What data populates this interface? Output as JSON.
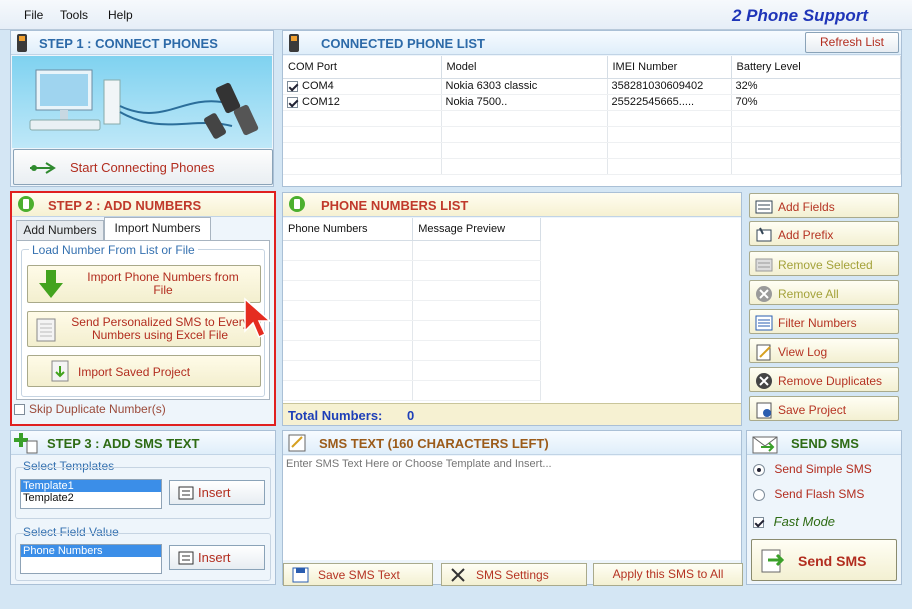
{
  "menu": {
    "file": "File",
    "tools": "Tools",
    "help": "Help"
  },
  "app_title": "2 Phone Support",
  "step1": {
    "title": "STEP 1 : CONNECT PHONES",
    "connect_button": "Start Connecting Phones"
  },
  "connected": {
    "title": "CONNECTED PHONE LIST",
    "refresh": "Refresh List",
    "columns": [
      "COM  Port",
      "Model",
      "IMEI Number",
      "Battery Level"
    ],
    "rows": [
      {
        "port": "COM4",
        "model": "Nokia 6303 classic",
        "imei": "358281030609402",
        "battery": "32%"
      },
      {
        "port": "COM12",
        "model": "Nokia 7500..",
        "imei": "25522545665.....",
        "battery": "70%"
      }
    ]
  },
  "step2": {
    "title": "STEP 2 : ADD NUMBERS",
    "tab_add": "Add Numbers",
    "tab_import": "Import Numbers",
    "group": "Load Number From List or File",
    "import_line1": "Import Phone Numbers from",
    "import_line2": "File",
    "excel_line1": "Send Personalized SMS to Every",
    "excel_line2": "Numbers using Excel File",
    "project": "Import Saved Project",
    "skip": "Skip Duplicate Number(s)"
  },
  "numbers": {
    "title": "PHONE NUMBERS LIST",
    "columns": [
      "Phone Numbers",
      "Message Preview"
    ],
    "total_label": "Total Numbers:",
    "total_value": "0"
  },
  "side_buttons": [
    {
      "label": "Add Fields",
      "name": "add-fields-button",
      "icon": "fields-icon"
    },
    {
      "label": "Add Prefix",
      "name": "add-prefix-button",
      "icon": "prefix-icon"
    },
    {
      "label": "Remove Selected",
      "name": "remove-selected-button",
      "icon": "remove-selected-icon"
    },
    {
      "label": "Remove All",
      "name": "remove-all-button",
      "icon": "remove-all-icon"
    },
    {
      "label": "Filter Numbers",
      "name": "filter-numbers-button",
      "icon": "filter-icon"
    },
    {
      "label": "View Log",
      "name": "view-log-button",
      "icon": "log-icon"
    },
    {
      "label": "Remove Duplicates",
      "name": "remove-duplicates-button",
      "icon": "duplicates-icon"
    },
    {
      "label": "Save Project",
      "name": "save-project-button",
      "icon": "save-icon"
    }
  ],
  "step3": {
    "title": "STEP 3 : ADD SMS TEXT",
    "templates_label": "Select Templates",
    "templates": [
      "Template1",
      "Template2"
    ],
    "insert": "Insert",
    "field_label": "Select Field Value",
    "fields": [
      "Phone Numbers"
    ],
    "insert2": "Insert"
  },
  "smstext": {
    "title": "SMS TEXT (160 CHARACTERS LEFT)",
    "placeholder": "Enter SMS Text Here or Choose Template and Insert...",
    "save": "Save SMS Text",
    "settings": "SMS Settings",
    "apply": "Apply this SMS to All"
  },
  "send": {
    "title": "SEND SMS",
    "simple": "Send Simple SMS",
    "flash": "Send Flash SMS",
    "fast": "Fast Mode",
    "button": "Send SMS"
  },
  "colors": {
    "accent_blue": "#2d6aa8",
    "accent_red": "#c0392b",
    "highlight_red": "#e02020",
    "selection": "#3b8ee8"
  }
}
